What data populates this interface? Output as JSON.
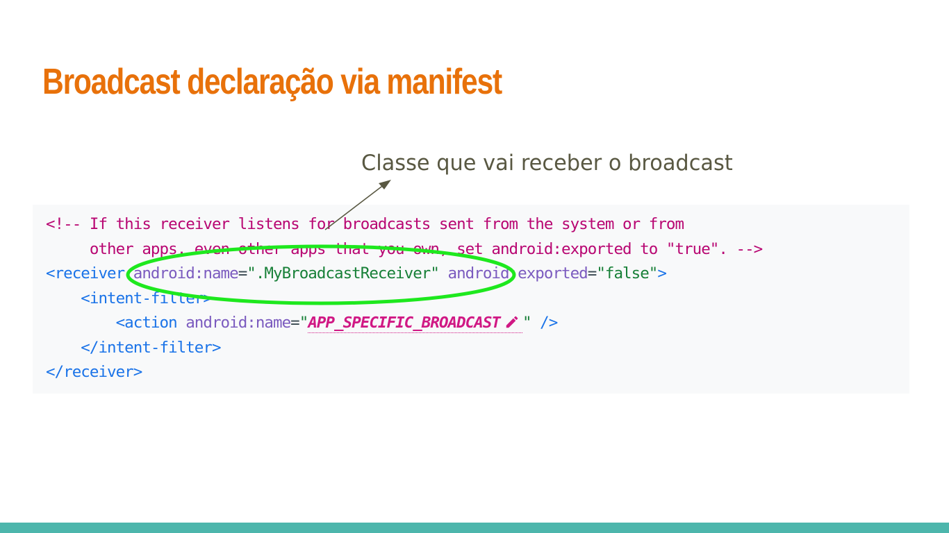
{
  "slide": {
    "title": "Broadcast declaração via manifest",
    "callout": "Classe que vai receber o broadcast"
  },
  "code": {
    "comment_line1": "<!-- If this receiver listens for broadcasts sent from the system or from",
    "comment_line2": "     other apps, even other apps that you own, set android:exported to \"true\". -->",
    "receiver_open": "<receiver",
    "attr_name": " android:name",
    "eq1": "=",
    "val_name": "\".MyBroadcastReceiver\"",
    "attr_exported": " android:exported",
    "eq2": "=",
    "val_exported": "\"false\"",
    "receiver_close_bracket": ">",
    "intent_filter_open": "    <intent-filter>",
    "action_tag": "        <action",
    "action_attr": " android:name",
    "eq3": "=",
    "quote_open": "\"",
    "action_value": "APP_SPECIFIC_BROADCAST",
    "quote_close": "\"",
    "action_end": " />",
    "intent_filter_close": "    </intent-filter>",
    "receiver_close": "</receiver>"
  },
  "icons": {
    "edit": "pencil-edit-icon"
  },
  "colors": {
    "title": "#e8710a",
    "callout_text": "#595842",
    "code_background": "#f8f9fa",
    "comment": "#b80672",
    "tag": "#1a73e8",
    "attribute": "#7b5bbf",
    "string": "#188038",
    "punctuation": "#37474f",
    "placeholder": "#d01884",
    "ellipse": "#1ee81e",
    "arrow": "#595842",
    "bottom_bar": "#4db6ac"
  }
}
